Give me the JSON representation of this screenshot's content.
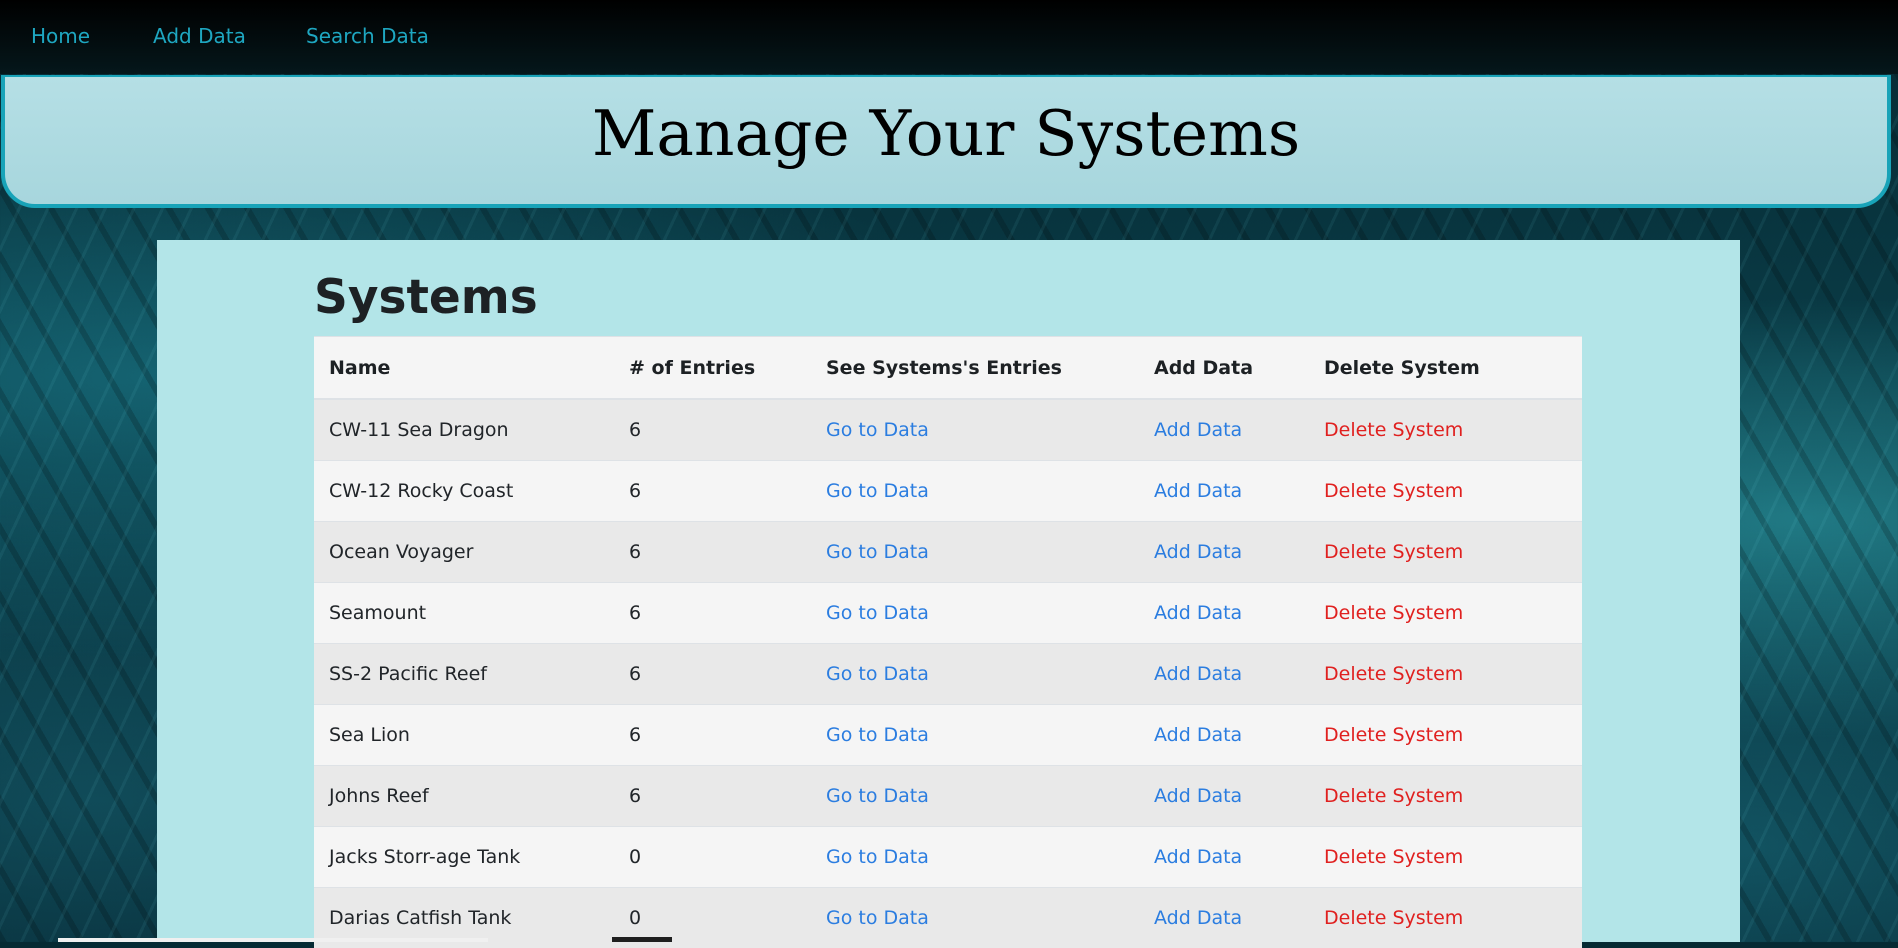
{
  "nav": {
    "links": [
      "Home",
      "Add Data",
      "Search Data"
    ]
  },
  "header": {
    "title": "Manage Your Systems"
  },
  "systems": {
    "heading": "Systems",
    "columns": [
      "Name",
      "# of Entries",
      "See Systems's Entries",
      "Add Data",
      "Delete System"
    ],
    "rows": [
      {
        "name": "CW-11 Sea Dragon",
        "entries": "6",
        "see": "Go to Data",
        "add": "Add Data",
        "delete": "Delete System"
      },
      {
        "name": "CW-12 Rocky Coast",
        "entries": "6",
        "see": "Go to Data",
        "add": "Add Data",
        "delete": "Delete System"
      },
      {
        "name": "Ocean Voyager",
        "entries": "6",
        "see": "Go to Data",
        "add": "Add Data",
        "delete": "Delete System"
      },
      {
        "name": "Seamount",
        "entries": "6",
        "see": "Go to Data",
        "add": "Add Data",
        "delete": "Delete System"
      },
      {
        "name": "SS-2 Pacific Reef",
        "entries": "6",
        "see": "Go to Data",
        "add": "Add Data",
        "delete": "Delete System"
      },
      {
        "name": "Sea Lion",
        "entries": "6",
        "see": "Go to Data",
        "add": "Add Data",
        "delete": "Delete System"
      },
      {
        "name": "Johns Reef",
        "entries": "6",
        "see": "Go to Data",
        "add": "Add Data",
        "delete": "Delete System"
      },
      {
        "name": "Jacks Storr-age Tank",
        "entries": "0",
        "see": "Go to Data",
        "add": "Add Data",
        "delete": "Delete System"
      },
      {
        "name": "Darias Catfish Tank",
        "entries": "0",
        "see": "Go to Data",
        "add": "Add Data",
        "delete": "Delete System"
      }
    ]
  },
  "colors": {
    "nav_link": "#1ea7c1",
    "link_blue": "#2b7de0",
    "link_red": "#e0201f",
    "panel_bg": "#b3e5e8",
    "banner_border": "#18a3b8"
  }
}
